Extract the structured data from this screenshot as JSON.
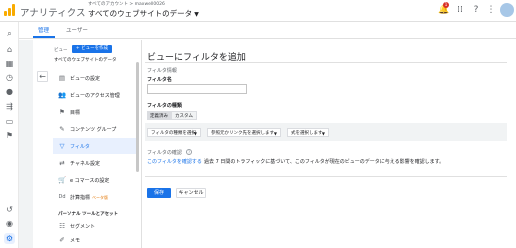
{
  "header": {
    "app_name": "アナリティクス",
    "account_sub": "すべてのアカウント > maxwell0026",
    "account_main": "すべてのウェブサイトのデータ",
    "notification_count": "1"
  },
  "tabs": [
    {
      "label": "管理"
    },
    {
      "label": "ユーザー"
    }
  ],
  "view_panel": {
    "label": "ビュー",
    "add_button": "+ ビューを作成",
    "view_name": "すべてのウェブサイトのデータ",
    "items": [
      {
        "label": "ビューの設定",
        "icon": "document-icon"
      },
      {
        "label": "ビューのアクセス管理",
        "icon": "users-icon"
      },
      {
        "label": "目標",
        "icon": "flag-icon"
      },
      {
        "label": "コンテンツ グループ",
        "icon": "content-group-icon"
      },
      {
        "label": "フィルタ",
        "icon": "filter-icon"
      },
      {
        "label": "チャネル設定",
        "icon": "channel-icon"
      },
      {
        "label": "e コマースの設定",
        "icon": "cart-icon"
      },
      {
        "label": "計算指標",
        "icon": "calculated-metric-icon",
        "badge": "ベータ版"
      }
    ],
    "personal_section": "パーソナル ツールとアセット",
    "personal_items": [
      {
        "label": "セグメント",
        "icon": "segment-icon"
      },
      {
        "label": "メモ",
        "icon": "memo-icon"
      }
    ]
  },
  "form": {
    "title": "ビューにフィルタを追加",
    "info_section": "フィルタ情報",
    "name_label": "フィルタ名",
    "name_value": "",
    "type_label": "フィルタの種類",
    "type_options": [
      "定義済み",
      "カスタム"
    ],
    "selected_type": "定義済み",
    "dropdowns": [
      {
        "value": "フィルタの種類を選択"
      },
      {
        "value": "参照元かリンク先を選択します"
      },
      {
        "value": "式を選択します"
      }
    ],
    "confirm_label": "フィルタの確認",
    "verify_link": "このフィルタを確認する",
    "verify_desc": "過去 7 日間のトラフィックに基づいて、このフィルタが現在のビューのデータに与える影響を確認します。",
    "save_label": "保存",
    "cancel_label": "キャンセル"
  },
  "colors": {
    "accent": "#1a73e8",
    "logo": "#f9ab00",
    "badge": "#d93025"
  }
}
